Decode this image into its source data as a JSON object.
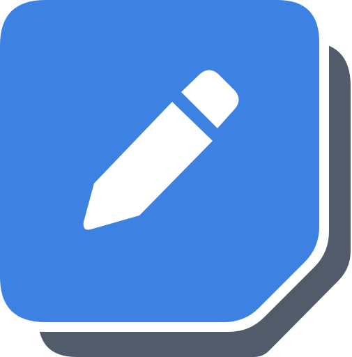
{
  "icon": {
    "name": "pencil-edit-app-icon",
    "glyph": "pencil-icon",
    "colors": {
      "tile": "#3d81e3",
      "tile_border": "#ffffff",
      "shadow": "#525b69",
      "glyph": "#ffffff"
    }
  }
}
